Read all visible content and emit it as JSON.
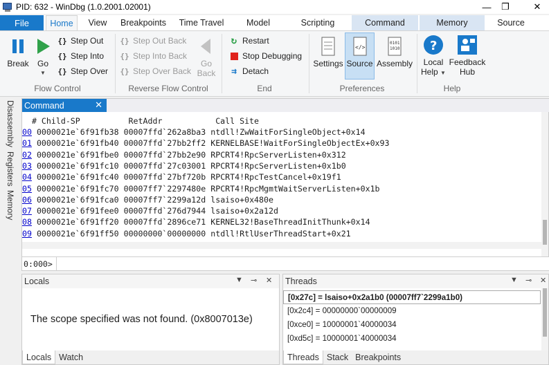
{
  "window": {
    "title": "PID: 632 - WinDbg (1.0.2001.02001)",
    "minimize": "—",
    "maximize": "❐",
    "close": "✕"
  },
  "ribbon": {
    "file_label": "File",
    "tabs": [
      {
        "label": "Home",
        "active": true
      },
      {
        "label": "View"
      },
      {
        "label": "Breakpoints"
      },
      {
        "label": "Time Travel"
      },
      {
        "label": "Model"
      },
      {
        "label": "Scripting"
      },
      {
        "label": "Command"
      },
      {
        "label": "Memory"
      },
      {
        "label": "Source"
      }
    ],
    "flow_control": {
      "label": "Flow Control",
      "break": "Break",
      "go": "Go",
      "step_out": "Step Out",
      "step_into": "Step Into",
      "step_over": "Step Over"
    },
    "reverse_flow_control": {
      "label": "Reverse Flow Control",
      "step_out_back": "Step Out Back",
      "step_into_back": "Step Into Back",
      "step_over_back": "Step Over Back",
      "go_back_1": "Go",
      "go_back_2": "Back"
    },
    "end": {
      "label": "End",
      "restart": "Restart",
      "stop": "Stop Debugging",
      "detach": "Detach"
    },
    "preferences": {
      "label": "Preferences",
      "settings": "Settings",
      "source": "Source",
      "assembly": "Assembly"
    },
    "help": {
      "label": "Help",
      "local_help_1": "Local",
      "local_help_2": "Help",
      "feedback_1": "Feedback",
      "feedback_2": "Hub"
    }
  },
  "sidetabs": [
    "Disassembly",
    "Registers",
    "Memory"
  ],
  "command": {
    "tab_label": "Command",
    "close": "✕",
    "header": "  # Child-SP          RetAddr           Call Site",
    "frames": [
      {
        "num": "00",
        "child_sp": "0000021e`6f91fb38",
        "ret": "00007ffd`262a8ba3",
        "site": "ntdll!ZwWaitForSingleObject+0x14"
      },
      {
        "num": "01",
        "child_sp": "0000021e`6f91fb40",
        "ret": "00007ffd`27bb2ff2",
        "site": "KERNELBASE!WaitForSingleObjectEx+0x93"
      },
      {
        "num": "02",
        "child_sp": "0000021e`6f91fbe0",
        "ret": "00007ffd`27bb2e90",
        "site": "RPCRT4!RpcServerListen+0x312"
      },
      {
        "num": "03",
        "child_sp": "0000021e`6f91fc10",
        "ret": "00007ffd`27c03001",
        "site": "RPCRT4!RpcServerListen+0x1b0"
      },
      {
        "num": "04",
        "child_sp": "0000021e`6f91fc40",
        "ret": "00007ffd`27bf720b",
        "site": "RPCRT4!RpcTestCancel+0x19f1"
      },
      {
        "num": "05",
        "child_sp": "0000021e`6f91fc70",
        "ret": "00007ff7`2297480e",
        "site": "RPCRT4!RpcMgmtWaitServerListen+0x1b"
      },
      {
        "num": "06",
        "child_sp": "0000021e`6f91fca0",
        "ret": "00007ff7`2299a12d",
        "site": "lsaiso+0x480e"
      },
      {
        "num": "07",
        "child_sp": "0000021e`6f91fee0",
        "ret": "00007ffd`276d7944",
        "site": "lsaiso+0x2a12d"
      },
      {
        "num": "08",
        "child_sp": "0000021e`6f91ff20",
        "ret": "00007ffd`2896ce71",
        "site": "KERNEL32!BaseThreadInitThunk+0x14"
      },
      {
        "num": "09",
        "child_sp": "0000021e`6f91ff50",
        "ret": "00000000`00000000",
        "site": "ntdll!RtlUserThreadStart+0x21"
      }
    ],
    "prompt": "0:000>",
    "input_value": ""
  },
  "locals": {
    "title": "Locals",
    "message": "The scope specified was not found. (0x8007013e)",
    "tabs": [
      "Locals",
      "Watch"
    ]
  },
  "threads": {
    "title": "Threads",
    "current": "[0x27c] = lsaiso+0x2a1b0 (00007ff7`2299a1b0)",
    "rows": [
      "[0x2c4] = 00000000`00000009",
      "[0xce0] = 10000001`40000034",
      "[0xd5c] = 10000001`40000034"
    ],
    "tabs": [
      "Threads",
      "Stack",
      "Breakpoints"
    ]
  },
  "pane_ctl": {
    "dropdown": "▼",
    "pin": "⊸",
    "close": "✕"
  }
}
